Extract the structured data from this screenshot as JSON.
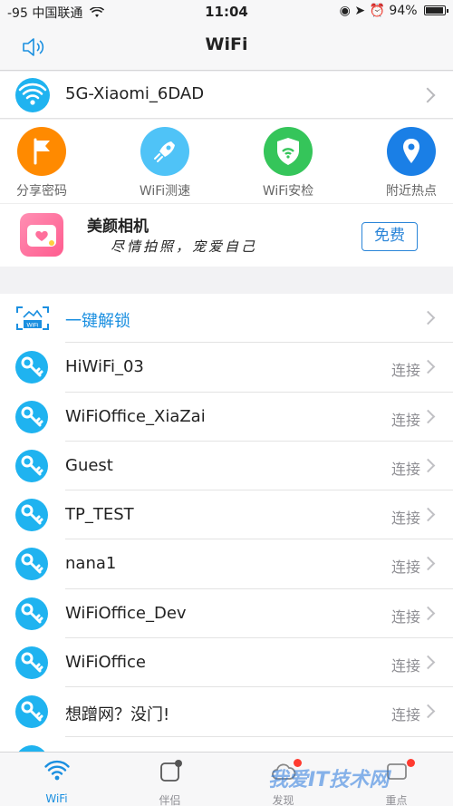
{
  "status": {
    "carrier": "-95 中国联通",
    "time": "11:04",
    "battery": "94%"
  },
  "nav": {
    "title": "WiFi"
  },
  "connected": {
    "ssid": "5G-Xiaomi_6DAD"
  },
  "tools": [
    {
      "label": "分享密码",
      "color": "#ff8a00",
      "icon": "flag-icon"
    },
    {
      "label": "WiFi测速",
      "color": "#4fc3f7",
      "icon": "rocket-icon"
    },
    {
      "label": "WiFi安检",
      "color": "#35c55a",
      "icon": "shield-icon"
    },
    {
      "label": "附近热点",
      "color": "#1a7fe6",
      "icon": "location-pin-icon"
    }
  ],
  "ad": {
    "name": "美颜相机",
    "slogan": "尽情拍照，宠爱自己",
    "button": "免费"
  },
  "unlock": {
    "label": "一键解锁",
    "badge": "WiFi"
  },
  "networks": [
    {
      "name": "HiWiFi_03",
      "action": "连接"
    },
    {
      "name": "WiFiOffice_XiaZai",
      "action": "连接"
    },
    {
      "name": "Guest",
      "action": "连接"
    },
    {
      "name": "TP_TEST",
      "action": "连接"
    },
    {
      "name": "nana1",
      "action": "连接"
    },
    {
      "name": "WiFiOffice_Dev",
      "action": "连接"
    },
    {
      "name": "WiFiOffice",
      "action": "连接"
    },
    {
      "name": "想蹭网？没门!",
      "action": "连接"
    }
  ],
  "tabs": [
    {
      "label": "WiFi"
    },
    {
      "label": "伴侣"
    },
    {
      "label": "发现"
    },
    {
      "label": "重点"
    }
  ],
  "watermark": "我爱IT技术网",
  "colors": {
    "accent": "#1a8fe0",
    "wifi_blue": "#1fb3f0",
    "badge_red": "#ff3b30"
  }
}
